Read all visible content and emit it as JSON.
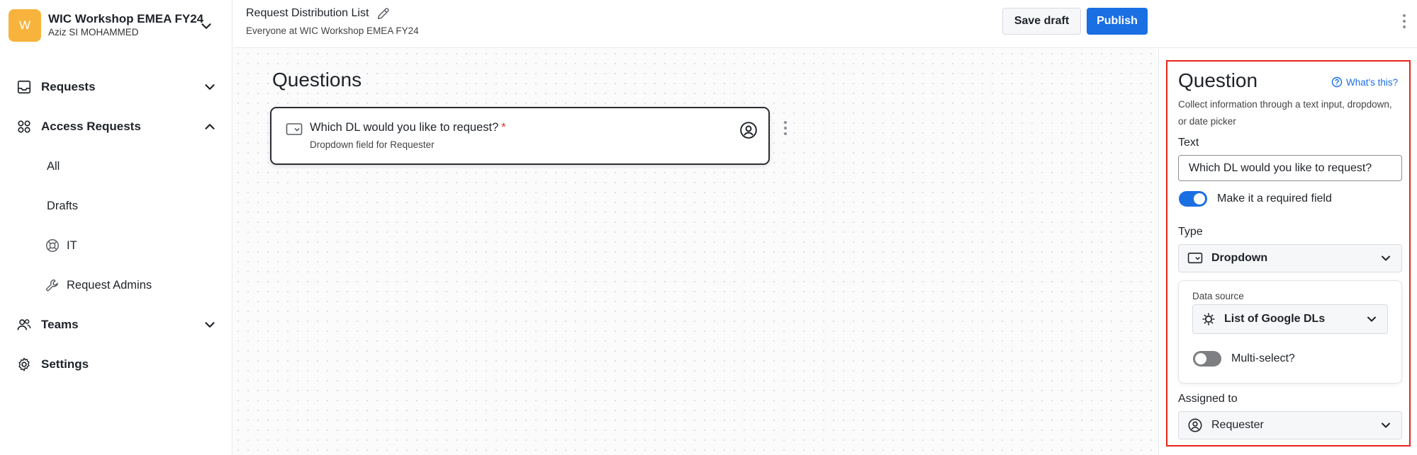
{
  "workspace": {
    "avatar_letter": "W",
    "name": "WIC Workshop EMEA FY24",
    "user": "Aziz SI MOHAMMED"
  },
  "sidebar": {
    "items": [
      {
        "label": "Requests",
        "icon": "inbox-icon"
      },
      {
        "label": "Access Requests",
        "icon": "apps-icon"
      },
      {
        "label": "Teams",
        "icon": "people-icon"
      },
      {
        "label": "Settings",
        "icon": "gear-icon"
      }
    ],
    "subitems": [
      {
        "label": "All"
      },
      {
        "label": "Drafts"
      },
      {
        "label": "IT",
        "icon": "lifebuoy-icon"
      },
      {
        "label": "Request Admins",
        "icon": "wrench-icon"
      }
    ]
  },
  "header": {
    "title": "Request Distribution List",
    "subtitle": "Everyone at WIC Workshop EMEA FY24",
    "save_label": "Save draft",
    "publish_label": "Publish"
  },
  "canvas": {
    "heading": "Questions",
    "question": {
      "text": "Which DL would you like to request?",
      "required_mark": "*",
      "subtitle": "Dropdown field for Requester"
    }
  },
  "panel": {
    "title": "Question",
    "help_label": "What's this?",
    "description": "Collect information through a text input, dropdown, or date picker",
    "text_label": "Text",
    "text_value": "Which DL would you like to request?",
    "required_label": "Make it a required field",
    "required_on": true,
    "type_label": "Type",
    "type_value": "Dropdown",
    "data_source_label": "Data source",
    "data_source_value": "List of Google DLs",
    "multiselect_label": "Multi-select?",
    "multiselect_on": false,
    "assigned_label": "Assigned to",
    "assigned_value": "Requester"
  },
  "colors": {
    "accent": "#1a6fe3",
    "avatar": "#f7b33b",
    "highlight_frame": "#e8251b",
    "required_mark": "#d9302c"
  }
}
